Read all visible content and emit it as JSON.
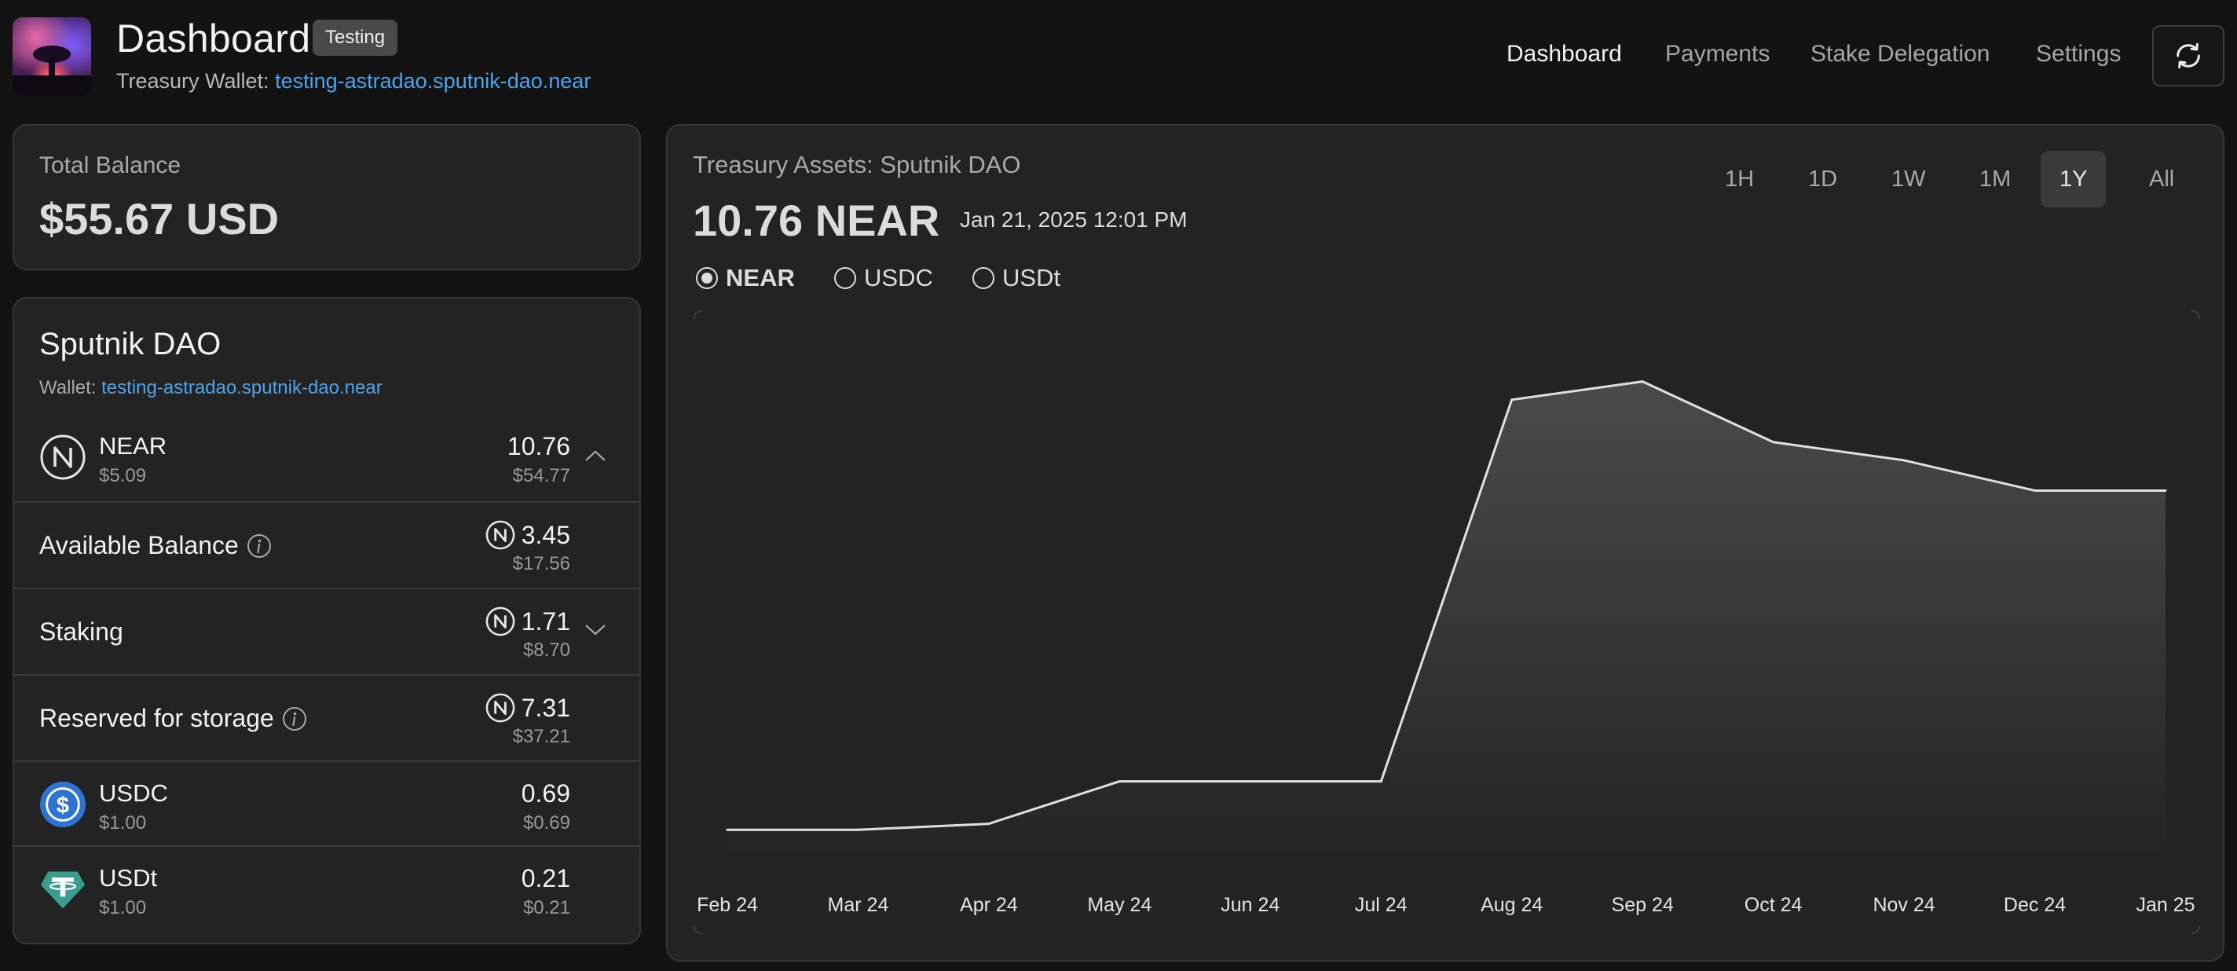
{
  "header": {
    "title": "Dashboard",
    "badge": "Testing",
    "wallet_label": "Treasury Wallet:",
    "wallet_address": "testing-astradao.sputnik-dao.near",
    "nav": [
      "Dashboard",
      "Payments",
      "Stake Delegation",
      "Settings"
    ],
    "active_nav": "Dashboard",
    "refresh_icon": "refresh-icon"
  },
  "total_balance": {
    "label": "Total Balance",
    "value": "$55.67 USD"
  },
  "dao": {
    "name": "Sputnik DAO",
    "wallet_label": "Wallet:",
    "wallet_address": "testing-astradao.sputnik-dao.near",
    "near": {
      "name": "NEAR",
      "price": "$5.09",
      "amount": "10.76",
      "usd": "$54.77",
      "icon": "near-icon"
    },
    "available": {
      "label": "Available Balance",
      "amount": "3.45",
      "usd": "$17.56"
    },
    "staking": {
      "label": "Staking",
      "amount": "1.71",
      "usd": "$8.70"
    },
    "reserved": {
      "label": "Reserved for storage",
      "amount": "7.31",
      "usd": "$37.21"
    },
    "usdc": {
      "name": "USDC",
      "price": "$1.00",
      "amount": "0.69",
      "usd": "$0.69",
      "icon": "usdc-icon"
    },
    "usdt": {
      "name": "USDt",
      "price": "$1.00",
      "amount": "0.21",
      "usd": "$0.21",
      "icon": "usdt-icon"
    }
  },
  "chart_card": {
    "title": "Treasury Assets: Sputnik DAO",
    "value": "10.76 NEAR",
    "date": "Jan 21, 2025 12:01 PM",
    "ranges": [
      "1H",
      "1D",
      "1W",
      "1M",
      "1Y",
      "All"
    ],
    "active_range": "1Y",
    "tokens": [
      "NEAR",
      "USDC",
      "USDt"
    ],
    "selected_token": "NEAR"
  },
  "colors": {
    "accent_link": "#4ea3ea",
    "line": "#e0e0e0",
    "usdc": "#2f74d0",
    "usdt": "#3a9e8f"
  },
  "chart_data": {
    "type": "area",
    "categories": [
      "Feb 24",
      "Mar 24",
      "Apr 24",
      "May 24",
      "Jun 24",
      "Jul 24",
      "Aug 24",
      "Sep 24",
      "Oct 24",
      "Nov 24",
      "Dec 24",
      "Jan 25"
    ],
    "series": [
      {
        "values": [
          0.1,
          0.1,
          0.2,
          0.9,
          0.9,
          0.9,
          7.2,
          7.5,
          6.5,
          6.2,
          5.7,
          5.7
        ]
      }
    ],
    "ylim": [
      0,
      9
    ],
    "grid": false,
    "legend": "none"
  }
}
